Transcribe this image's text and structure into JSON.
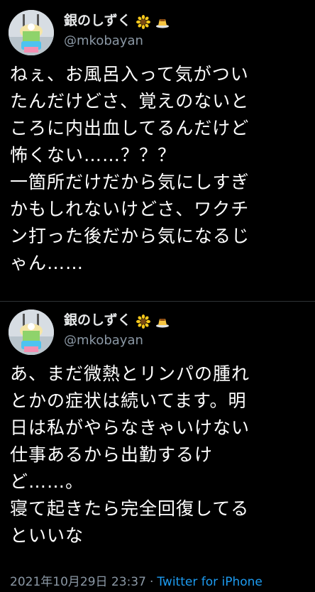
{
  "tweets": [
    {
      "display_name": "銀のしずく",
      "emojis": [
        "sunflower-emoji",
        "pudding-emoji"
      ],
      "handle": "@mkobayan",
      "text": "ねぇ、お風呂入って気がつい\nたんだけどさ、覚えのないと\nころに内出血してるんだけど\n怖くない……？？？\n一箇所だけだから気にしすぎ\nかもしれないけどさ、ワクチ\nン打った後だから気になるじ\nゃん……"
    },
    {
      "display_name": "銀のしずく",
      "emojis": [
        "sunflower-emoji",
        "pudding-emoji"
      ],
      "handle": "@mkobayan",
      "text": "あ、まだ微熱とリンパの腫れ\nとかの症状は続いてます。明\n日は私がやらなきゃいけない\n仕事あるから出勤するけ\nど……。\n寝て起きたら完全回復してる\nといいな",
      "timestamp": "2021年10月29日 23:37",
      "separator": "·",
      "source": "Twitter for iPhone"
    }
  ],
  "colors": {
    "background": "#000000",
    "text": "#ffffff",
    "secondary": "#8b98a5",
    "link": "#1d9bf0",
    "divider": "#2f3336"
  }
}
